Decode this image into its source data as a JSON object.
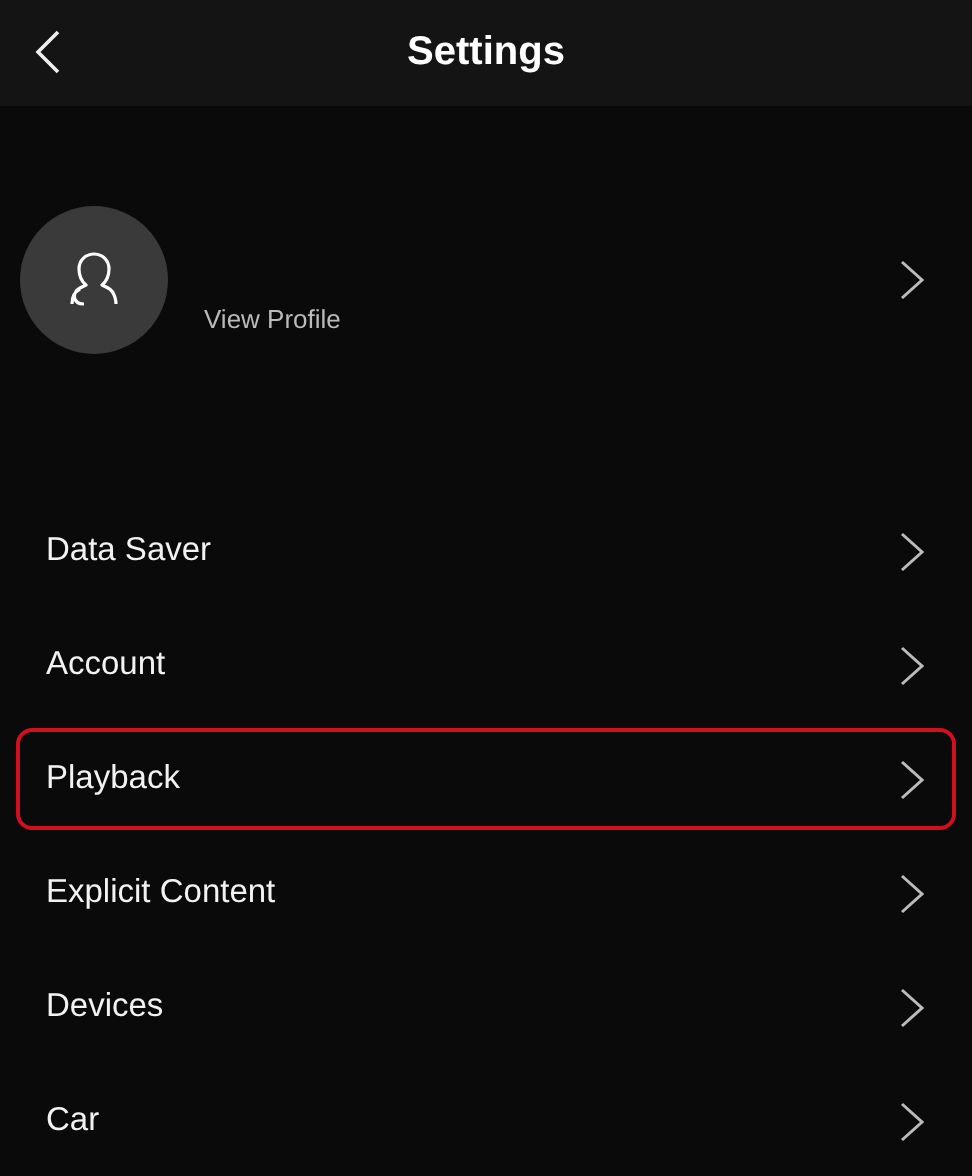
{
  "header": {
    "title": "Settings"
  },
  "profile": {
    "link": "View Profile"
  },
  "items": [
    {
      "label": "Data Saver",
      "highlighted": false
    },
    {
      "label": "Account",
      "highlighted": false
    },
    {
      "label": "Playback",
      "highlighted": true
    },
    {
      "label": "Explicit Content",
      "highlighted": false
    },
    {
      "label": "Devices",
      "highlighted": false
    },
    {
      "label": "Car",
      "highlighted": false
    }
  ]
}
